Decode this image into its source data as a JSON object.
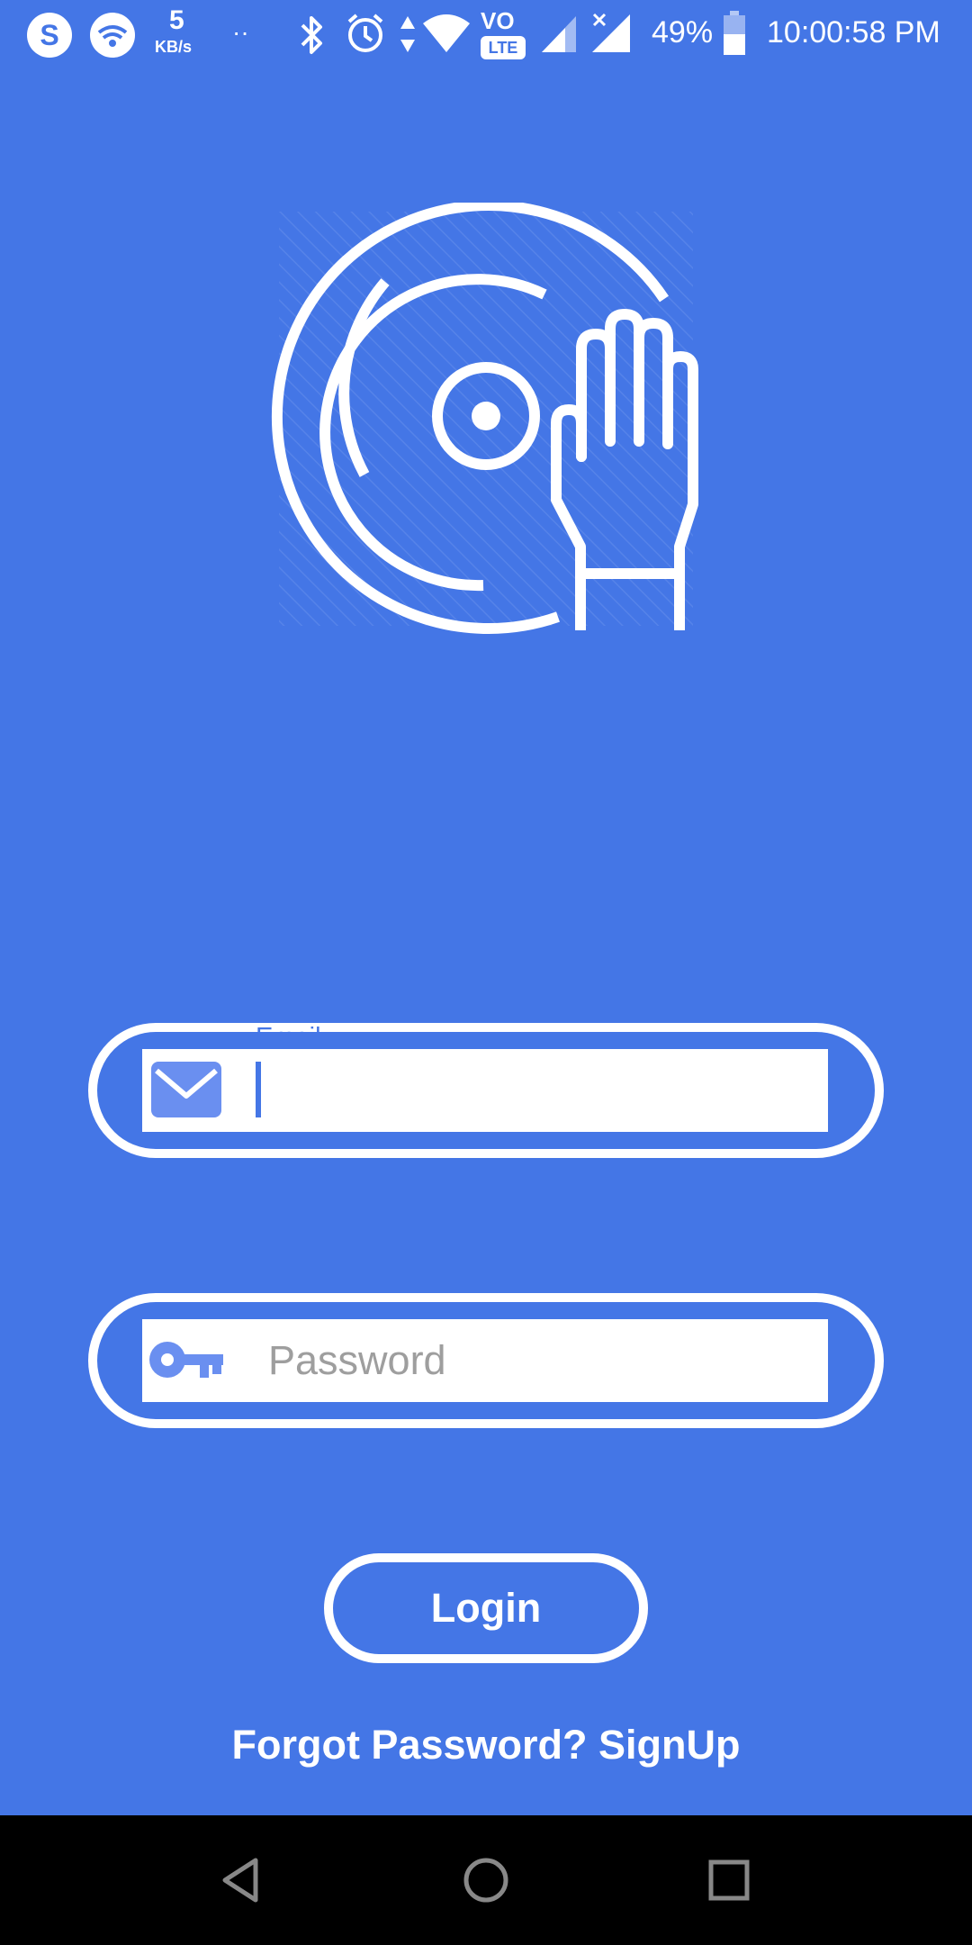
{
  "status_bar": {
    "speed_value": "5",
    "speed_unit": "KB/s",
    "dots": "··",
    "volte_label": "VO",
    "lte_label": "LTE",
    "battery": "49%",
    "time": "10:00:58 PM"
  },
  "login_form": {
    "email_label": "Email",
    "email_value": "",
    "password_placeholder": "Password",
    "login_label": "Login",
    "forgot_label": "Forgot Password?",
    "signup_label": "SignUp"
  },
  "colors": {
    "background": "#4476E6",
    "foreground": "#FFFFFF",
    "nav_bar": "#000000"
  },
  "icons": [
    "skype-icon",
    "wifi-icon",
    "bluetooth-icon",
    "alarm-icon",
    "data-arrows-icon",
    "signal-icon",
    "battery-icon",
    "dj-turntable-logo",
    "email-icon",
    "key-icon",
    "back-icon",
    "home-icon",
    "recents-icon"
  ]
}
